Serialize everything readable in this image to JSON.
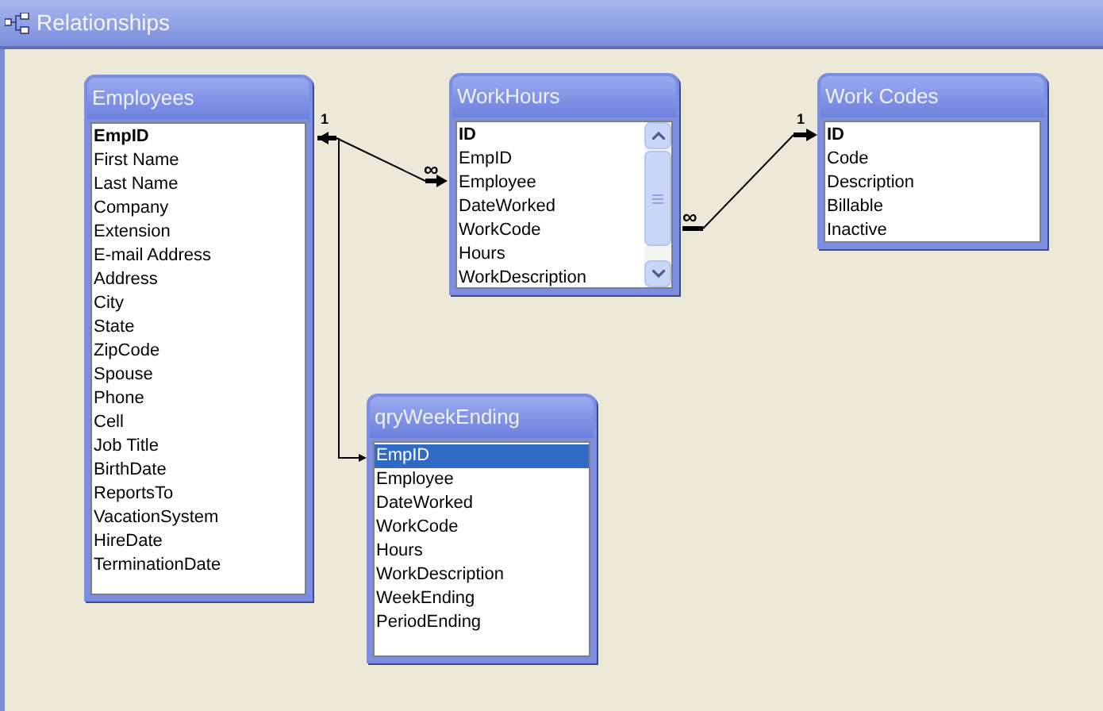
{
  "window": {
    "title": "Relationships"
  },
  "tables": [
    {
      "title": "Employees",
      "scrollable": false,
      "fields": [
        {
          "name": "EmpID",
          "key": true,
          "selected": false
        },
        {
          "name": "First Name",
          "key": false,
          "selected": false
        },
        {
          "name": "Last Name",
          "key": false,
          "selected": false
        },
        {
          "name": "Company",
          "key": false,
          "selected": false
        },
        {
          "name": "Extension",
          "key": false,
          "selected": false
        },
        {
          "name": "E-mail Address",
          "key": false,
          "selected": false
        },
        {
          "name": "Address",
          "key": false,
          "selected": false
        },
        {
          "name": "City",
          "key": false,
          "selected": false
        },
        {
          "name": "State",
          "key": false,
          "selected": false
        },
        {
          "name": "ZipCode",
          "key": false,
          "selected": false
        },
        {
          "name": "Spouse",
          "key": false,
          "selected": false
        },
        {
          "name": "Phone",
          "key": false,
          "selected": false
        },
        {
          "name": "Cell",
          "key": false,
          "selected": false
        },
        {
          "name": "Job Title",
          "key": false,
          "selected": false
        },
        {
          "name": "BirthDate",
          "key": false,
          "selected": false
        },
        {
          "name": "ReportsTo",
          "key": false,
          "selected": false
        },
        {
          "name": "VacationSystem",
          "key": false,
          "selected": false
        },
        {
          "name": "HireDate",
          "key": false,
          "selected": false
        },
        {
          "name": "TerminationDate",
          "key": false,
          "selected": false
        }
      ]
    },
    {
      "title": "WorkHours",
      "scrollable": true,
      "fields": [
        {
          "name": "ID",
          "key": true,
          "selected": false
        },
        {
          "name": "EmpID",
          "key": false,
          "selected": false
        },
        {
          "name": "Employee",
          "key": false,
          "selected": false
        },
        {
          "name": "DateWorked",
          "key": false,
          "selected": false
        },
        {
          "name": "WorkCode",
          "key": false,
          "selected": false
        },
        {
          "name": "Hours",
          "key": false,
          "selected": false
        },
        {
          "name": "WorkDescription",
          "key": false,
          "selected": false
        }
      ]
    },
    {
      "title": "Work Codes",
      "scrollable": false,
      "fields": [
        {
          "name": "ID",
          "key": true,
          "selected": false
        },
        {
          "name": "Code",
          "key": false,
          "selected": false
        },
        {
          "name": "Description",
          "key": false,
          "selected": false
        },
        {
          "name": "Billable",
          "key": false,
          "selected": false
        },
        {
          "name": "Inactive",
          "key": false,
          "selected": false
        }
      ]
    },
    {
      "title": "qryWeekEnding",
      "scrollable": false,
      "fields": [
        {
          "name": "EmpID",
          "key": false,
          "selected": true
        },
        {
          "name": "Employee",
          "key": false,
          "selected": false
        },
        {
          "name": "DateWorked",
          "key": false,
          "selected": false
        },
        {
          "name": "WorkCode",
          "key": false,
          "selected": false
        },
        {
          "name": "Hours",
          "key": false,
          "selected": false
        },
        {
          "name": "WorkDescription",
          "key": false,
          "selected": false
        },
        {
          "name": "WeekEnding",
          "key": false,
          "selected": false
        },
        {
          "name": "PeriodEnding",
          "key": false,
          "selected": false
        }
      ]
    }
  ],
  "relationships": [
    {
      "one_label": "1",
      "many_label": "∞"
    },
    {
      "one_label": "1",
      "many_label": "∞"
    }
  ]
}
